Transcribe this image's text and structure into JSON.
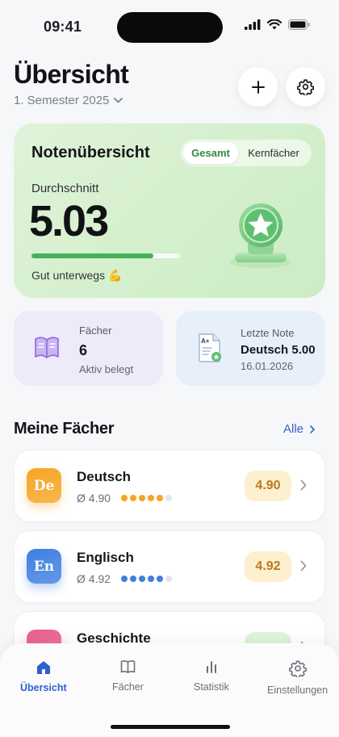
{
  "status_bar": {
    "time": "09:41"
  },
  "header": {
    "title": "Übersicht",
    "semester": "1. Semester 2025"
  },
  "overview_card": {
    "title": "Notenübersicht",
    "segments": [
      "Gesamt",
      "Kernfächer"
    ],
    "selected_segment": "Gesamt",
    "average_label": "Durchschnitt",
    "average_value": "5.03",
    "progress": 0.82,
    "status_text": "Gut unterwegs 💪"
  },
  "stats": {
    "faecher": {
      "label": "Fächer",
      "value": "6",
      "sub": "Aktiv belegt"
    },
    "last_grade": {
      "label": "Letzte Note",
      "value": "Deutsch 5.00",
      "date": "16.01.2026"
    }
  },
  "section": {
    "title": "Meine Fächer",
    "link": "Alle"
  },
  "subjects": [
    {
      "abbr": "De",
      "name": "Deutsch",
      "avg": "Ø 4.90",
      "grade": "4.90",
      "dots_filled": 5,
      "color": "#f5a524",
      "pill_bg": "#fdf0cf",
      "pill_text": "#b7791f"
    },
    {
      "abbr": "En",
      "name": "Englisch",
      "avg": "Ø 4.92",
      "grade": "4.92",
      "dots_filled": 5,
      "color": "#3f7fe0",
      "pill_bg": "#fdf0cf",
      "pill_text": "#b7791f"
    },
    {
      "abbr": "",
      "name": "Geschichte",
      "avg": "",
      "grade": "",
      "dots_filled": 0,
      "color": "#ea5e8f",
      "pill_bg": "#dff3d8",
      "pill_text": "#2f8a45"
    }
  ],
  "tabs": [
    "Übersicht",
    "Fächer",
    "Statistik",
    "Einstellungen"
  ],
  "active_tab": "Übersicht",
  "colors": {
    "accent": "#2d5fd1",
    "green": "#43b25a",
    "card_green": "#d9f1d2"
  }
}
